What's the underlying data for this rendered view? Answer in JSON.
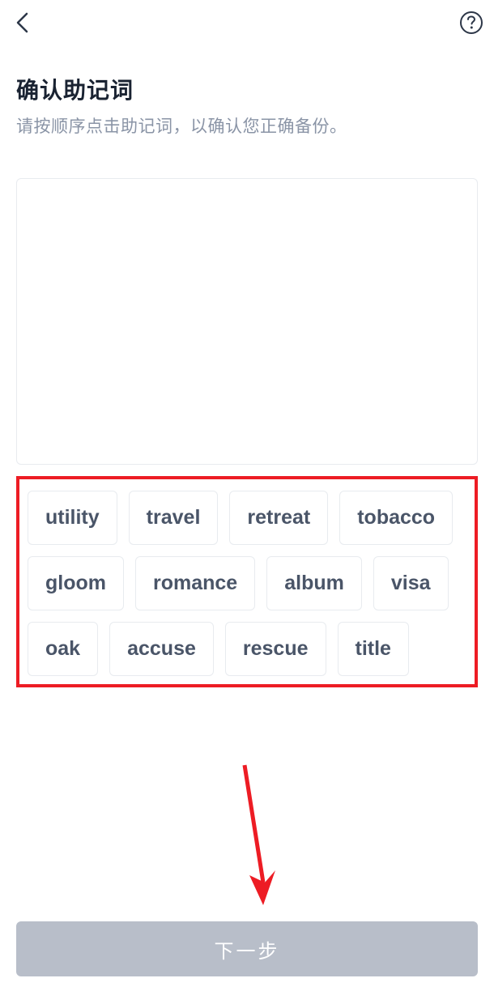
{
  "header": {
    "title": "确认助记词",
    "subtitle": "请按顺序点击助记词，以确认您正确备份。"
  },
  "words": [
    "utility",
    "travel",
    "retreat",
    "tobacco",
    "gloom",
    "romance",
    "album",
    "visa",
    "oak",
    "accuse",
    "rescue",
    "title"
  ],
  "button": {
    "next_label": "下一步"
  },
  "annotations": {
    "highlight_color": "#ed1c24",
    "arrow_color": "#ed1c24"
  }
}
